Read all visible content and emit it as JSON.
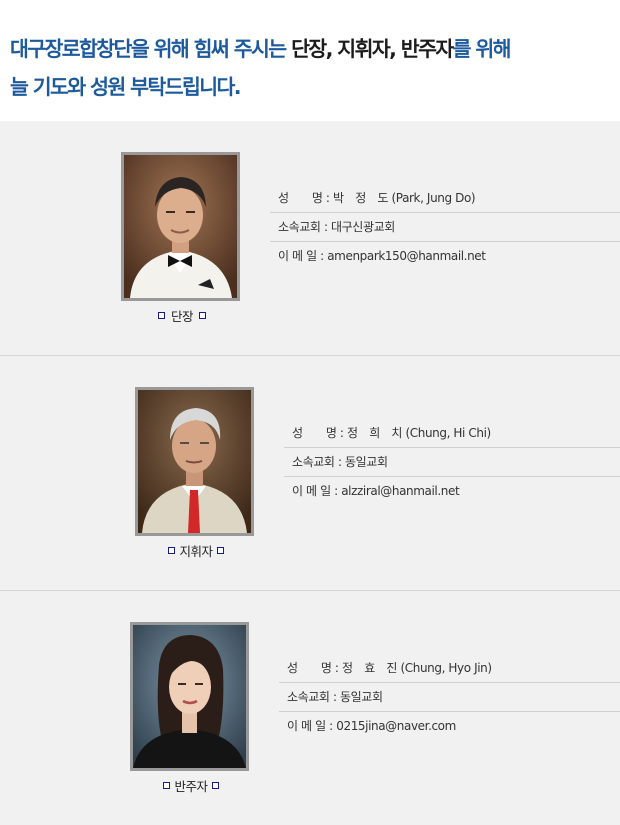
{
  "header": {
    "title_part1": "대구장로합창단을 위해 힘써 주시는 ",
    "title_part2": "단장, 지휘자, 반주자",
    "title_part3": "를 위해",
    "title_line2": "늘 기도와 성원 부탁드립니다."
  },
  "members": [
    {
      "role": "단장",
      "name_row": "성　　명 : 박　정　도 (Park, Jung Do)",
      "church_row": "소속교회 : 대구신광교회",
      "email_row": "이 메 일 : amenpark150@hanmail.net"
    },
    {
      "role": "지휘자",
      "name_row": "성　　명 : 정　희　치 (Chung, Hi Chi)",
      "church_row": "소속교회 : 동일교회",
      "email_row": "이 메 일 : alzziral@hanmail.net"
    },
    {
      "role": "반주자",
      "name_row": "성　　명 : 정　효　진 (Chung, Hyo Jin)",
      "church_row": "소속교회 : 동일교회",
      "email_row": "이 메 일 : 0215jina@naver.com"
    }
  ],
  "colors": {
    "accent": "#1d5a9c",
    "panel_bg": "#f1f1f1",
    "bullet": "#1a1a8a"
  }
}
